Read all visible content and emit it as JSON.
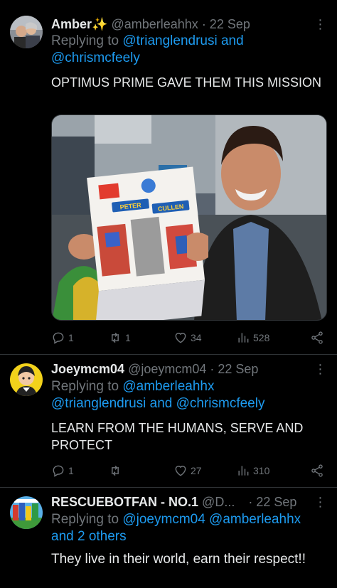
{
  "tweets": [
    {
      "name": "Amber✨",
      "handle": "@amberleahhx",
      "date": "· 22 Sep",
      "replying_prefix": "Replying to",
      "replying_line1": "@trianglendrusi and",
      "replying_line2": "@chrismcfeely",
      "text": "OPTIMUS PRIME GAVE THEM THIS MISSION",
      "image_sign": {
        "line1": "PETER",
        "line2": "CULLEN"
      },
      "replies": "1",
      "retweets": "1",
      "likes": "34",
      "views": "528"
    },
    {
      "name": "Joeymcm04",
      "handle": "@joeymcm04 · 22 Sep",
      "replying_prefix": "Replying to",
      "replying_mention1": "@amberleahhx",
      "replying_line2": "@trianglendrusi and @chrismcfeely",
      "text": "LEARN FROM THE HUMANS, SERVE AND PROTECT",
      "replies": "1",
      "retweets": "",
      "likes": "27",
      "views": "310"
    },
    {
      "name": "RESCUEBOTFAN - NO.1",
      "handle": "@D...",
      "date": "· 22 Sep",
      "replying_prefix": "Replying to",
      "replying_mentions": "@joeymcm04 @amberleahhx",
      "replying_line2": "and 2 others",
      "text": "They live in their world, earn their respect!!"
    }
  ]
}
